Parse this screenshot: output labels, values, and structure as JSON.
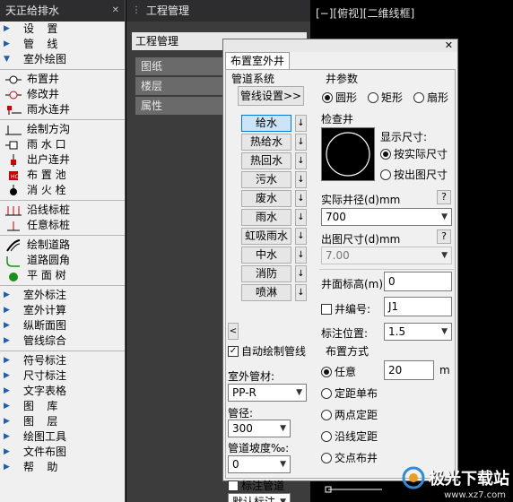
{
  "left_panel": {
    "title": "天正给排水",
    "items": [
      {
        "type": "item",
        "arrow": "right",
        "label": "设　置",
        "spread": true
      },
      {
        "type": "item",
        "arrow": "right",
        "label": "管　线",
        "spread": true
      },
      {
        "type": "item",
        "arrow": "down",
        "label": "室外绘图"
      },
      {
        "type": "sep"
      },
      {
        "type": "icon",
        "icon": "well-icon",
        "label": "布置井"
      },
      {
        "type": "icon",
        "icon": "edit-well-icon",
        "label": "修改井"
      },
      {
        "type": "icon",
        "icon": "rain-connect-icon",
        "label": "雨水连井"
      },
      {
        "type": "sep"
      },
      {
        "type": "icon",
        "icon": "square-well-icon",
        "label": "绘制方沟"
      },
      {
        "type": "icon",
        "icon": "rain-inlet-icon",
        "label": "雨 水 口"
      },
      {
        "type": "icon",
        "icon": "outfall-icon",
        "label": "出户连井"
      },
      {
        "type": "icon",
        "icon": "pool-icon",
        "label": "布 置 池"
      },
      {
        "type": "icon",
        "icon": "hydrant-icon",
        "label": "消 火 栓"
      },
      {
        "type": "sep"
      },
      {
        "type": "icon",
        "icon": "pile-icon",
        "label": "沿线标桩"
      },
      {
        "type": "icon",
        "icon": "pile-single-icon",
        "label": "任意标桩"
      },
      {
        "type": "sep"
      },
      {
        "type": "icon",
        "icon": "road-icon",
        "label": "绘制道路"
      },
      {
        "type": "icon",
        "icon": "road-corner-icon",
        "label": "道路圆角"
      },
      {
        "type": "icon",
        "icon": "tree-icon",
        "label": "平 面 树"
      },
      {
        "type": "sep"
      },
      {
        "type": "item",
        "arrow": "right",
        "label": "室外标注"
      },
      {
        "type": "item",
        "arrow": "right",
        "label": "室外计算"
      },
      {
        "type": "item",
        "arrow": "right",
        "label": "纵断面图"
      },
      {
        "type": "item",
        "arrow": "right",
        "label": "管线综合"
      },
      {
        "type": "sep"
      },
      {
        "type": "item",
        "arrow": "right",
        "label": "符号标注"
      },
      {
        "type": "item",
        "arrow": "right",
        "label": "尺寸标注"
      },
      {
        "type": "item",
        "arrow": "right",
        "label": "文字表格"
      },
      {
        "type": "item",
        "arrow": "right",
        "label": "图　库",
        "spread": true
      },
      {
        "type": "item",
        "arrow": "right",
        "label": "图　层",
        "spread": true
      },
      {
        "type": "item",
        "arrow": "right",
        "label": "绘图工具"
      },
      {
        "type": "item",
        "arrow": "right",
        "label": "文件布图"
      },
      {
        "type": "item",
        "arrow": "right",
        "label": "帮　助",
        "spread": true
      }
    ]
  },
  "project_panel": {
    "title": "工程管理",
    "header": "工程管理",
    "tabs": [
      "图纸",
      "楼层",
      "属性"
    ]
  },
  "view": {
    "label": "[−][俯视][二维线框]"
  },
  "dialog": {
    "tab": "布置室外井",
    "pipe_system": {
      "legend": "管道系统",
      "settings_button": "管线设置>>",
      "pipes": [
        "给水",
        "热给水",
        "热回水",
        "污水",
        "废水",
        "雨水",
        "虹吸雨水",
        "中水",
        "消防",
        "喷淋"
      ],
      "selected": "给水",
      "down_arrow": "↓",
      "left_arrow": "<",
      "auto_draw_label": "自动绘制管线",
      "auto_draw_checked": true
    },
    "material": {
      "label": "室外管材:",
      "value": "PP-R",
      "diameter_label": "管径:",
      "diameter_value": "300",
      "slope_label": "管道坡度‰:",
      "slope_value": "0",
      "mark_label": "标注管道",
      "mark_checked": false,
      "mark_style": "默认标注"
    },
    "well_params": {
      "legend": "井参数",
      "shapes": [
        "圆形",
        "矩形",
        "扇形"
      ],
      "shape_selected": "圆形",
      "inspection_label": "检查井",
      "display_size_label": "显示尺寸:",
      "display_options": [
        "按实际尺寸",
        "按出图尺寸"
      ],
      "display_selected": "按实际尺寸",
      "actual_diameter_label": "实际井径(d)mm",
      "actual_diameter_value": "700",
      "drawing_size_label": "出图尺寸(d)mm",
      "drawing_size_value": "7.00",
      "help": "?",
      "elevation_label": "井面标高(m):",
      "elevation_value": "0",
      "number_label": "井编号:",
      "number_value": "J1",
      "number_checked": false,
      "label_pos_label": "标注位置:",
      "label_pos_value": "1.5"
    },
    "layout": {
      "legend": "布置方式",
      "options": [
        "任意",
        "定距单布",
        "两点定距",
        "沿线定距",
        "交点布井"
      ],
      "selected": "任意",
      "distance_value": "20",
      "unit": "m"
    },
    "close": "✕"
  },
  "watermark": {
    "text": "极光下载站",
    "url": "www.xz7.com"
  }
}
